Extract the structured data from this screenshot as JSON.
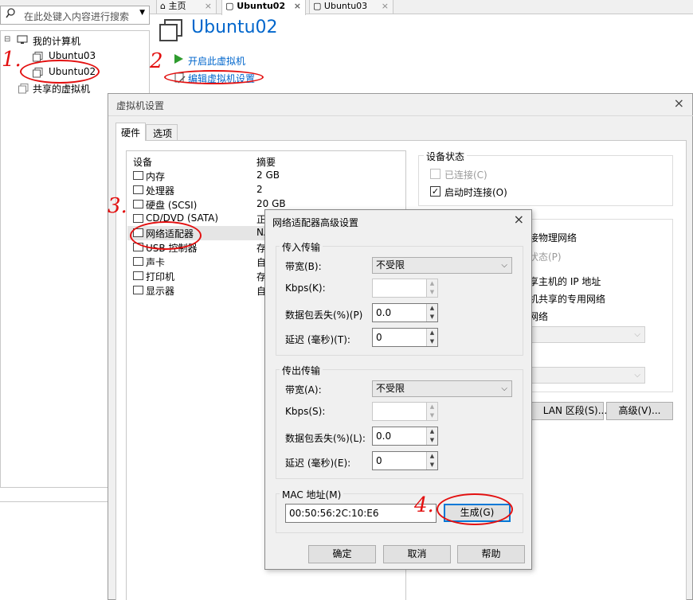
{
  "colors": {
    "accent": "#0078d7",
    "link": "#0066cc",
    "annotation": "#e31010",
    "play": "#2e9b2e"
  },
  "search": {
    "placeholder": "在此处键入内容进行搜索"
  },
  "tabs": [
    {
      "label": "主页"
    },
    {
      "label": "Ubuntu02"
    },
    {
      "label": "Ubuntu03"
    }
  ],
  "tree": {
    "my_computer": "我的计算机",
    "vms": [
      "Ubuntu03",
      "Ubuntu02"
    ],
    "shared": "共享的虚拟机"
  },
  "vm_page": {
    "title": "Ubuntu02",
    "start_link": "开启此虚拟机",
    "edit_link": "编辑虚拟机设置"
  },
  "settings_dialog": {
    "title": "虚拟机设置",
    "tabs": [
      "硬件",
      "选项"
    ],
    "columns": {
      "device": "设备",
      "summary": "摘要"
    },
    "devices": [
      {
        "name": "内存",
        "summary": "2 GB",
        "icon": "memory-icon"
      },
      {
        "name": "处理器",
        "summary": "2",
        "icon": "cpu-icon"
      },
      {
        "name": "硬盘 (SCSI)",
        "summary": "20 GB",
        "icon": "disk-icon"
      },
      {
        "name": "CD/DVD (SATA)",
        "summary": "正在",
        "icon": "cd-icon"
      },
      {
        "name": "网络适配器",
        "summary": "NA",
        "icon": "network-icon"
      },
      {
        "name": "USB 控制器",
        "summary": "存在",
        "icon": "usb-icon"
      },
      {
        "name": "声卡",
        "summary": "自动",
        "icon": "sound-icon"
      },
      {
        "name": "打印机",
        "summary": "存在",
        "icon": "printer-icon"
      },
      {
        "name": "显示器",
        "summary": "自动",
        "icon": "display-icon"
      }
    ],
    "device_status": {
      "title": "设备状态",
      "connected": "已连接(C)",
      "connect_on_start": "启动时连接(O)",
      "connect_on_start_checked": true
    },
    "right_partial": {
      "line1": "接物理网络",
      "line2": "状态(P)",
      "line3": "享主机的 IP 地址",
      "line4": "机共享的专用网络",
      "line5": "网络",
      "lan_button": "LAN 区段(S)...",
      "advanced_button": "高级(V)..."
    }
  },
  "adv_dialog": {
    "title": "网络适配器高级设置",
    "incoming": {
      "title": "传入传输",
      "bandwidth_label": "带宽(B):",
      "bandwidth_value": "不受限",
      "kbps_label": "Kbps(K):",
      "kbps_value": "",
      "loss_label": "数据包丢失(%)(P)",
      "loss_value": "0.0",
      "latency_label": "延迟 (毫秒)(T):",
      "latency_value": "0"
    },
    "outgoing": {
      "title": "传出传输",
      "bandwidth_label": "带宽(A):",
      "bandwidth_value": "不受限",
      "kbps_label": "Kbps(S):",
      "kbps_value": "",
      "loss_label": "数据包丢失(%)(L):",
      "loss_value": "0.0",
      "latency_label": "延迟 (毫秒)(E):",
      "latency_value": "0"
    },
    "mac": {
      "title": "MAC 地址(M)",
      "value": "00:50:56:2C:10:E6",
      "generate_button": "生成(G)"
    },
    "buttons": {
      "ok": "确定",
      "cancel": "取消",
      "help": "帮助"
    }
  },
  "annotations": [
    "1.",
    "2",
    "3.",
    "4."
  ]
}
